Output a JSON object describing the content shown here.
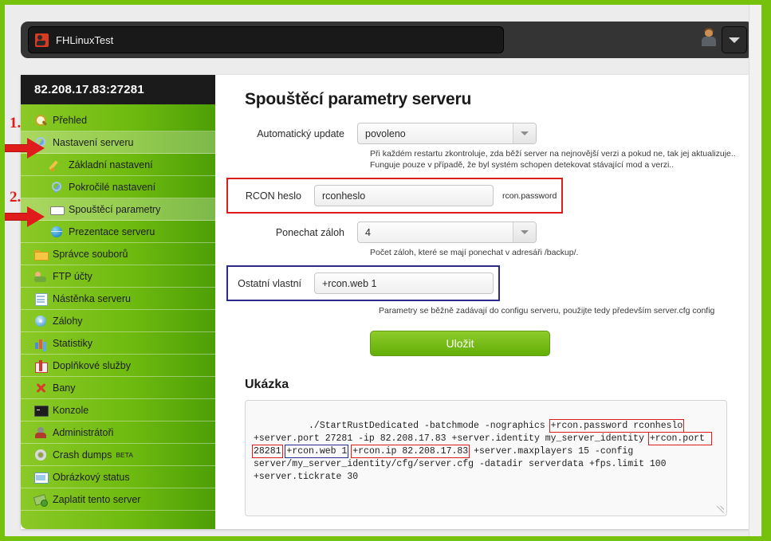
{
  "browser": {
    "tab_title": "FHLinuxTest",
    "favicon_name": "rust-favicon",
    "avatar_name": "user-avatar-icon",
    "dropdown_name": "tab-list-dropdown"
  },
  "sidebar": {
    "header": "82.208.17.83:27281",
    "items": [
      {
        "label": "Přehled",
        "icon": "magnifier-icon",
        "level": 0,
        "active": false,
        "badge": ""
      },
      {
        "label": "Nastavení serveru",
        "icon": "wrench-icon",
        "level": 0,
        "active": true,
        "badge": ""
      },
      {
        "label": "Základní nastavení",
        "icon": "pencil-icon",
        "level": 1,
        "active": false,
        "badge": ""
      },
      {
        "label": "Pokročilé nastavení",
        "icon": "wrench-icon",
        "level": 1,
        "active": false,
        "badge": ""
      },
      {
        "label": "Spouštěcí parametry",
        "icon": "panel-icon",
        "level": 1,
        "active": true,
        "badge": ""
      },
      {
        "label": "Prezentace serveru",
        "icon": "globe-icon",
        "level": 1,
        "active": false,
        "badge": ""
      },
      {
        "label": "Správce souborů",
        "icon": "folder-icon",
        "level": 0,
        "active": false,
        "badge": ""
      },
      {
        "label": "FTP účty",
        "icon": "ftp-users-icon",
        "level": 0,
        "active": false,
        "badge": ""
      },
      {
        "label": "Nástěnka serveru",
        "icon": "board-icon",
        "level": 0,
        "active": false,
        "badge": ""
      },
      {
        "label": "Zálohy",
        "icon": "disc-icon",
        "level": 0,
        "active": false,
        "badge": ""
      },
      {
        "label": "Statistiky",
        "icon": "bar-chart-icon",
        "level": 0,
        "active": false,
        "badge": ""
      },
      {
        "label": "Doplňkové služby",
        "icon": "gift-icon",
        "level": 0,
        "active": false,
        "badge": ""
      },
      {
        "label": "Bany",
        "icon": "red-x-icon",
        "level": 0,
        "active": false,
        "badge": ""
      },
      {
        "label": "Konzole",
        "icon": "console-icon",
        "level": 0,
        "active": false,
        "badge": ""
      },
      {
        "label": "Administrátoři",
        "icon": "admin-icon",
        "level": 0,
        "active": false,
        "badge": ""
      },
      {
        "label": "Crash dumps",
        "icon": "gear-icon",
        "level": 0,
        "active": false,
        "badge": "BETA"
      },
      {
        "label": "Obrázkový status",
        "icon": "image-icon",
        "level": 0,
        "active": false,
        "badge": ""
      },
      {
        "label": "Zaplatit tento server",
        "icon": "money-icon",
        "level": 0,
        "active": false,
        "badge": ""
      }
    ]
  },
  "main": {
    "title": "Spouštěcí parametry serveru",
    "fields": {
      "autoupdate": {
        "label": "Automatický update",
        "value": "povoleno",
        "help_line1": "Při každém restartu zkontroluje, zda běží server na nejnovější verzi a pokud ne, tak jej aktualizuje..",
        "help_line2": "Funguje pouze v případě, že byl systém schopen detekovat stávající mod a verzi.."
      },
      "rcon_password": {
        "label": "RCON heslo",
        "value": "rconheslo",
        "placeholder": "",
        "hint": "rcon.password"
      },
      "keep_backups": {
        "label": "Ponechat záloh",
        "value": "4",
        "help": "Počet záloh, které se mají ponechat v adresáři /backup/."
      },
      "other_custom": {
        "label": "Ostatní vlastní",
        "value": "+rcon.web 1",
        "placeholder": "",
        "help": "Parametry se běžně zadávají do configu serveru, použijte tedy především server.cfg config"
      }
    },
    "save_label": "Uložit",
    "example_title": "Ukázka",
    "example_segments": [
      {
        "text": "./StartRustDedicated -batchmode -nographics ",
        "mark": ""
      },
      {
        "text": "+rcon.password rconheslo",
        "mark": "red"
      },
      {
        "text": " +server.port 27281 -ip 82.208.17.83 +server.identity my_server_identity ",
        "mark": ""
      },
      {
        "text": "+rcon.port 28281",
        "mark": "red"
      },
      {
        "text": " ",
        "mark": ""
      },
      {
        "text": "+rcon.web 1",
        "mark": "blue"
      },
      {
        "text": " ",
        "mark": ""
      },
      {
        "text": "+rcon.ip 82.208.17.83",
        "mark": "red"
      },
      {
        "text": " +server.maxplayers 15 -config server/my_server_identity/cfg/server.cfg -datadir serverdata +fps.limit 100 +server.tickrate 30",
        "mark": ""
      }
    ]
  },
  "annotations": {
    "step1": "1.",
    "step2": "2.",
    "arrow1_name": "red-arrow-to-nastaveni-serveru",
    "arrow2_name": "red-arrow-to-spousteci-parametry",
    "highlight_rcon_color": "#e01b1b",
    "highlight_custom_color": "#2b2b8f"
  }
}
